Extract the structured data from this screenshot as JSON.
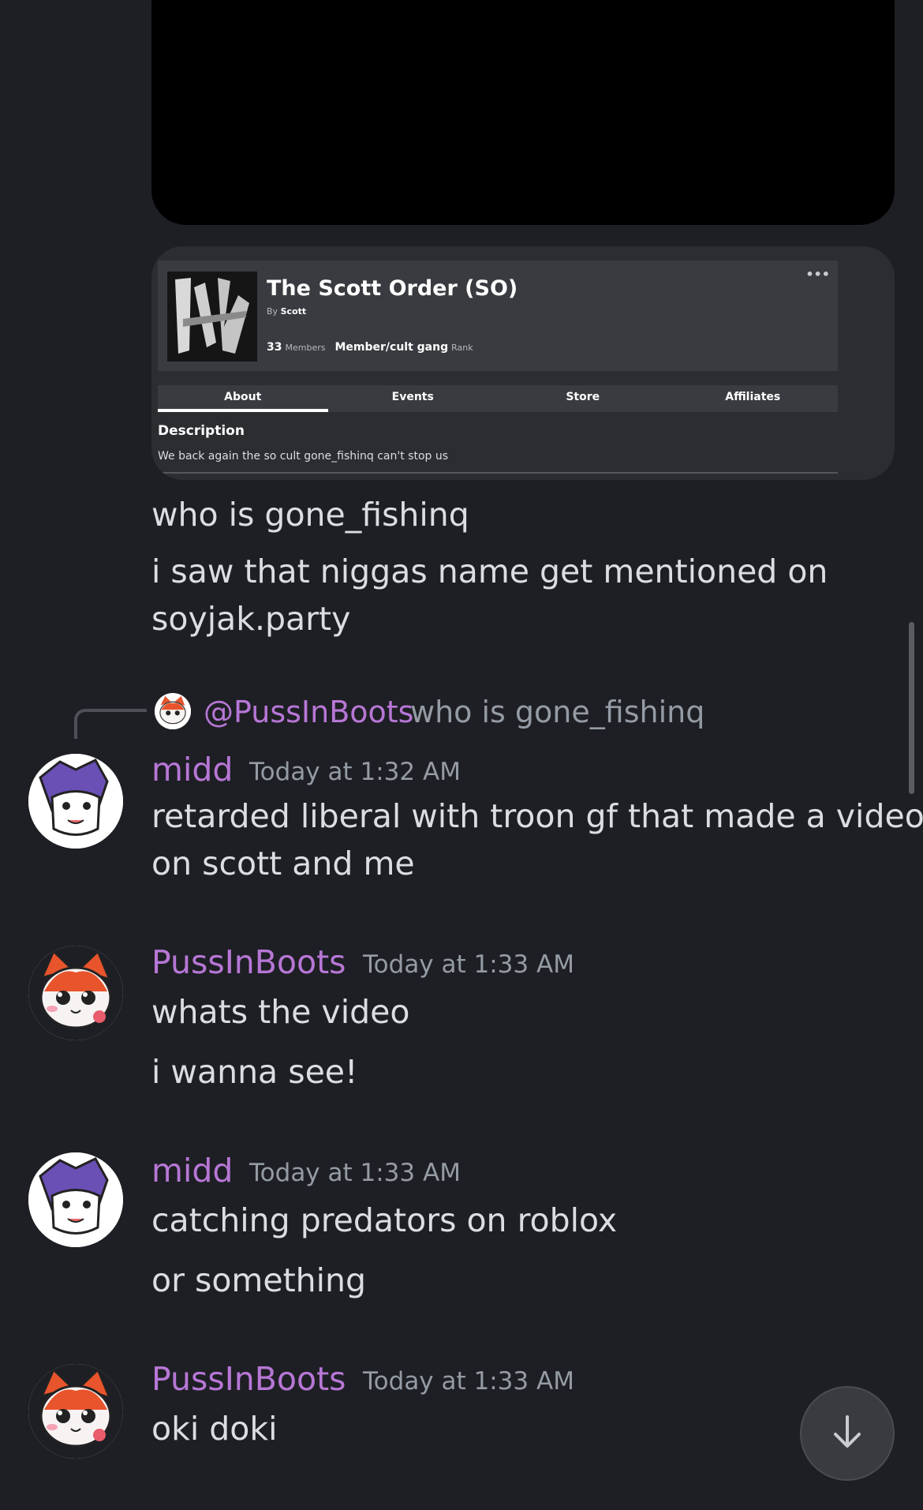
{
  "embed_card": {
    "title": "The Scott Order (SO)",
    "by_prefix": "By",
    "by_name": "Scott",
    "members_count": "33",
    "members_label": "Members",
    "rank_value": "Member/cult gang",
    "rank_label": "Rank",
    "more": "•••",
    "tabs": [
      "About",
      "Events",
      "Store",
      "Affiliates"
    ],
    "active_tab": "About",
    "description_title": "Description",
    "description_text": "We back again the so cult gone_fishinq can't stop us"
  },
  "messages": [
    {
      "lines": [
        "who is gone_fishinq",
        "i saw that niggas name get mentioned on",
        "soyjak.party"
      ]
    },
    {
      "reply": {
        "mention": "@PussInBoots",
        "text": "who is gone_fishinq"
      },
      "author": "midd",
      "timestamp": "Today at 1:32 AM",
      "lines": [
        "retarded liberal with troon gf that made a video",
        "on scott and me"
      ]
    },
    {
      "author": "PussInBoots",
      "timestamp": "Today at 1:33 AM",
      "lines": [
        "whats the video",
        "i wanna see!"
      ]
    },
    {
      "author": "midd",
      "timestamp": "Today at 1:33 AM",
      "lines": [
        "catching predators on roblox",
        "or something"
      ]
    },
    {
      "author": "PussInBoots",
      "timestamp": "Today at 1:33 AM",
      "lines": [
        "oki doki"
      ]
    }
  ],
  "colors": {
    "background": "#1e1f24",
    "username": "#b777d6",
    "timestamp": "#949ba4",
    "text": "#dbdee1"
  },
  "icons": {
    "jump": "arrow-down-icon"
  }
}
